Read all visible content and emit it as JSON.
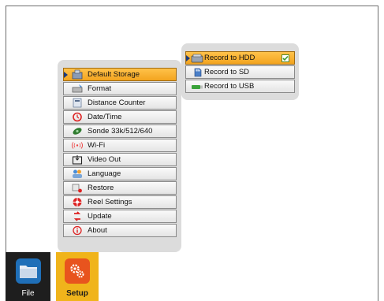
{
  "main_menu": {
    "items": [
      {
        "label": "Default Storage",
        "icon": "storage-icon",
        "selected": true
      },
      {
        "label": "Format",
        "icon": "format-drive-icon",
        "selected": false
      },
      {
        "label": "Distance Counter",
        "icon": "counter-icon",
        "selected": false
      },
      {
        "label": "Date/Time",
        "icon": "clock-icon",
        "selected": false
      },
      {
        "label": "Sonde 33k/512/640",
        "icon": "sonde-icon",
        "selected": false
      },
      {
        "label": "Wi-Fi",
        "icon": "wifi-icon",
        "selected": false
      },
      {
        "label": "Video Out",
        "icon": "video-out-icon",
        "selected": false
      },
      {
        "label": "Language",
        "icon": "language-icon",
        "selected": false
      },
      {
        "label": "Restore",
        "icon": "restore-icon",
        "selected": false
      },
      {
        "label": "Reel Settings",
        "icon": "reel-icon",
        "selected": false
      },
      {
        "label": "Update",
        "icon": "update-icon",
        "selected": false
      },
      {
        "label": "About",
        "icon": "info-icon",
        "selected": false
      }
    ]
  },
  "submenu": {
    "items": [
      {
        "label": "Record to HDD",
        "icon": "hdd-icon",
        "selected": true,
        "checked": true
      },
      {
        "label": "Record to SD",
        "icon": "sd-card-icon",
        "selected": false,
        "checked": false
      },
      {
        "label": "Record to USB",
        "icon": "usb-icon",
        "selected": false,
        "checked": false
      }
    ]
  },
  "tabs": {
    "file": {
      "label": "File",
      "icon": "folder-icon"
    },
    "setup": {
      "label": "Setup",
      "icon": "gears-icon"
    }
  },
  "colors": {
    "accent": "#f3a41f",
    "setup_tab": "#f0b41b",
    "file_tab": "#1e1e1e",
    "panel": "#dcdcdc"
  }
}
